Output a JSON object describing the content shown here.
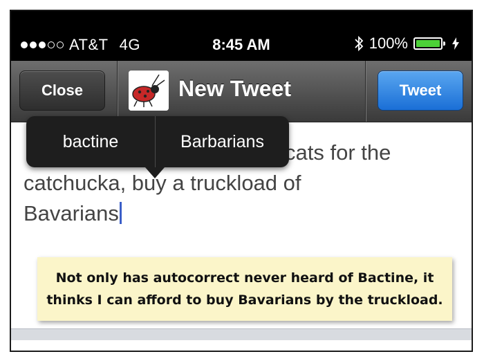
{
  "status_bar": {
    "carrier": "AT&T",
    "network": "4G",
    "time": "8:45 AM",
    "battery": "100%",
    "signal_bars_filled": 3,
    "signal_bars_total": 5,
    "battery_level": 1.0
  },
  "nav": {
    "close_label": "Close",
    "title": "New Tweet",
    "tweet_label": "Tweet"
  },
  "compose": {
    "line1": "cats for the",
    "line2": "catchucka, buy a truckload of",
    "line3": "Bavarians"
  },
  "autocorrect": {
    "options": [
      "bactine",
      "Barbarians"
    ]
  },
  "note": {
    "line1": "Not only has autocorrect never heard of Bactine, it",
    "line2": "thinks I can afford to buy Bavarians by the truckload."
  },
  "colors": {
    "tweet_button": "#1a6fd6",
    "battery_fill": "#4cd137",
    "cursor": "#3a5ec8",
    "note_background": "#fbf5c9"
  }
}
